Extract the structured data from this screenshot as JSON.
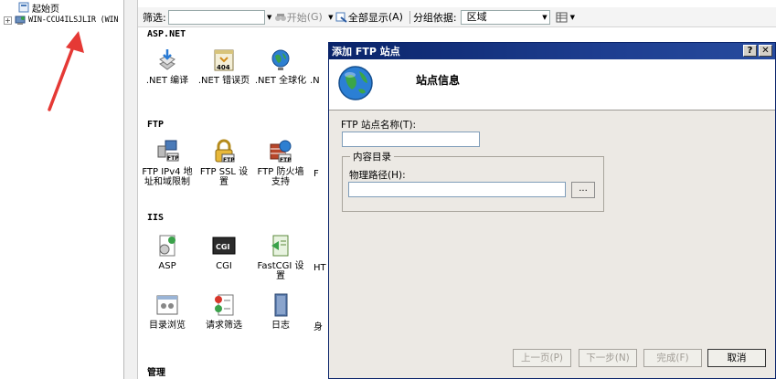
{
  "tree": {
    "items": [
      {
        "label": "起始页"
      },
      {
        "label": "WIN-CCU4ILSJLIR (WIN",
        "expander": "+"
      }
    ]
  },
  "toolbar": {
    "filter_label": "筛选:",
    "go_label": "开始",
    "go_shortcut": "(G)",
    "show_all_label": "全部显示",
    "show_all_shortcut": "(A)",
    "group_by_label": "分组依据:",
    "group_by_value": "区域"
  },
  "features": {
    "groups": [
      {
        "title": "ASP.NET",
        "items": [
          ".NET 编译",
          ".NET 错误页",
          ".NET 全球化",
          ".N"
        ]
      },
      {
        "title": "FTP",
        "items": [
          "FTP IPv4 地址和域限制",
          "FTP SSL 设置",
          "FTP 防火墙支持",
          "F"
        ]
      },
      {
        "title": "IIS",
        "items": [
          "ASP",
          "CGI",
          "FastCGI 设置",
          "HT",
          "目录浏览",
          "请求筛选",
          "日志",
          "身"
        ]
      },
      {
        "title": "管理",
        "items": []
      }
    ],
    "icon_badges": {
      "error_page": "404",
      "cgi": "CGI",
      "ftp": "FTP"
    }
  },
  "dialog": {
    "title": "添加 FTP 站点",
    "help_button": "?",
    "close_button": "✕",
    "header_title": "站点信息",
    "site_name_label": "FTP 站点名称(T):",
    "site_name_value": "",
    "content_dir_label": "内容目录",
    "physical_path_label": "物理路径(H):",
    "physical_path_value": "",
    "browse_label": "...",
    "buttons": {
      "prev": "上一页(P)",
      "next": "下一步(N)",
      "finish": "完成(F)",
      "cancel": "取消"
    }
  },
  "colors": {
    "title_bar": "#0a246a",
    "dialog_bg": "#ece9e4",
    "annotation_arrow": "#e53935"
  }
}
